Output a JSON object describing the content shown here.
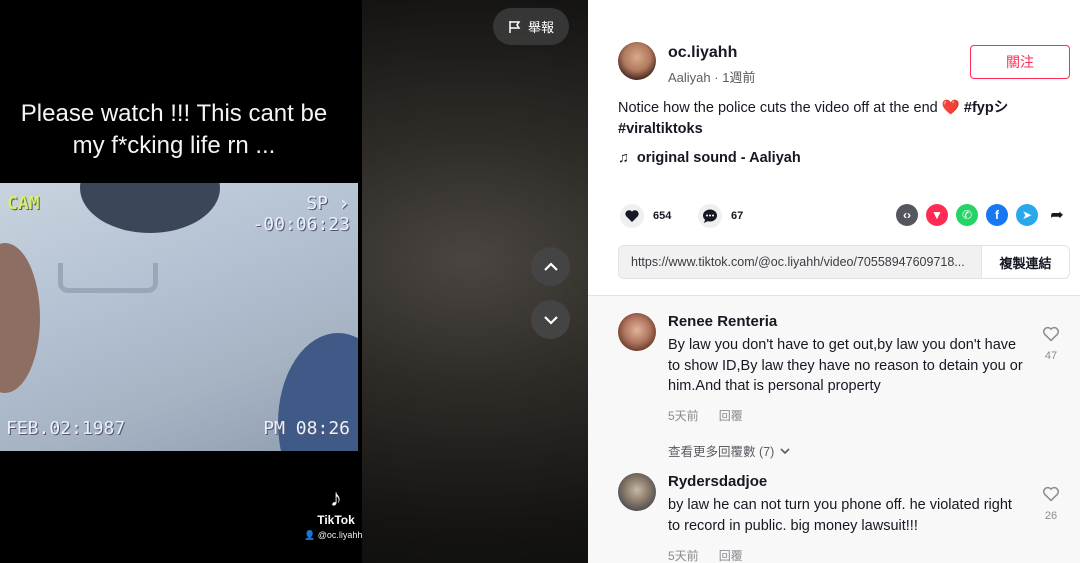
{
  "video": {
    "caption": "Please watch  !!! This cant be my f*cking life rn  ...",
    "vcr": {
      "cam_label": "CAM",
      "mode": "SP",
      "play_symbol": "›",
      "counter": "-00:06:23",
      "date": "FEB.02:1987",
      "time": "PM 08:26"
    },
    "watermark": {
      "brand": "TikTok",
      "user": "@oc.liyahh"
    },
    "report_label": "舉報"
  },
  "author": {
    "username": "oc.liyahh",
    "display_name": "Aaliyah",
    "separator": " · ",
    "posted": "1週前",
    "follow_label": "關注"
  },
  "post": {
    "description": "Notice how the police cuts the video off at the end",
    "emoji": "❤️",
    "tag_fyp": "#fypシ",
    "tag_viral": "#viraltiktoks",
    "music": "original sound - Aaliyah"
  },
  "stats": {
    "likes": "654",
    "comments": "67"
  },
  "share": {
    "url": "https://www.tiktok.com/@oc.liyahh/video/70558947609718...",
    "copy_label": "複製連結"
  },
  "comments": [
    {
      "username": "Renee Renteria",
      "text": "By law you don't have to get out,by law you don't have to show ID,By law they have no reason to detain you or him.And that is personal property",
      "time": "5天前",
      "reply_label": "回覆",
      "likes": "47",
      "view_replies": "查看更多回覆數 (7)"
    },
    {
      "username": "Rydersdadjoe",
      "text": "by law he can not turn you phone off. he violated right to record in public. big money lawsuit!!!",
      "time": "5天前",
      "reply_label": "回覆",
      "likes": "26"
    }
  ],
  "colors": {
    "accent": "#fe2c55",
    "text": "#161823",
    "muted": "#8a8b91"
  },
  "icons": [
    "flag-icon",
    "chevron-up-icon",
    "chevron-down-icon",
    "heart-icon",
    "comment-icon",
    "music-note-icon",
    "embed-icon",
    "tiktok-share-icon",
    "whatsapp-icon",
    "facebook-icon",
    "telegram-icon",
    "forward-icon"
  ]
}
